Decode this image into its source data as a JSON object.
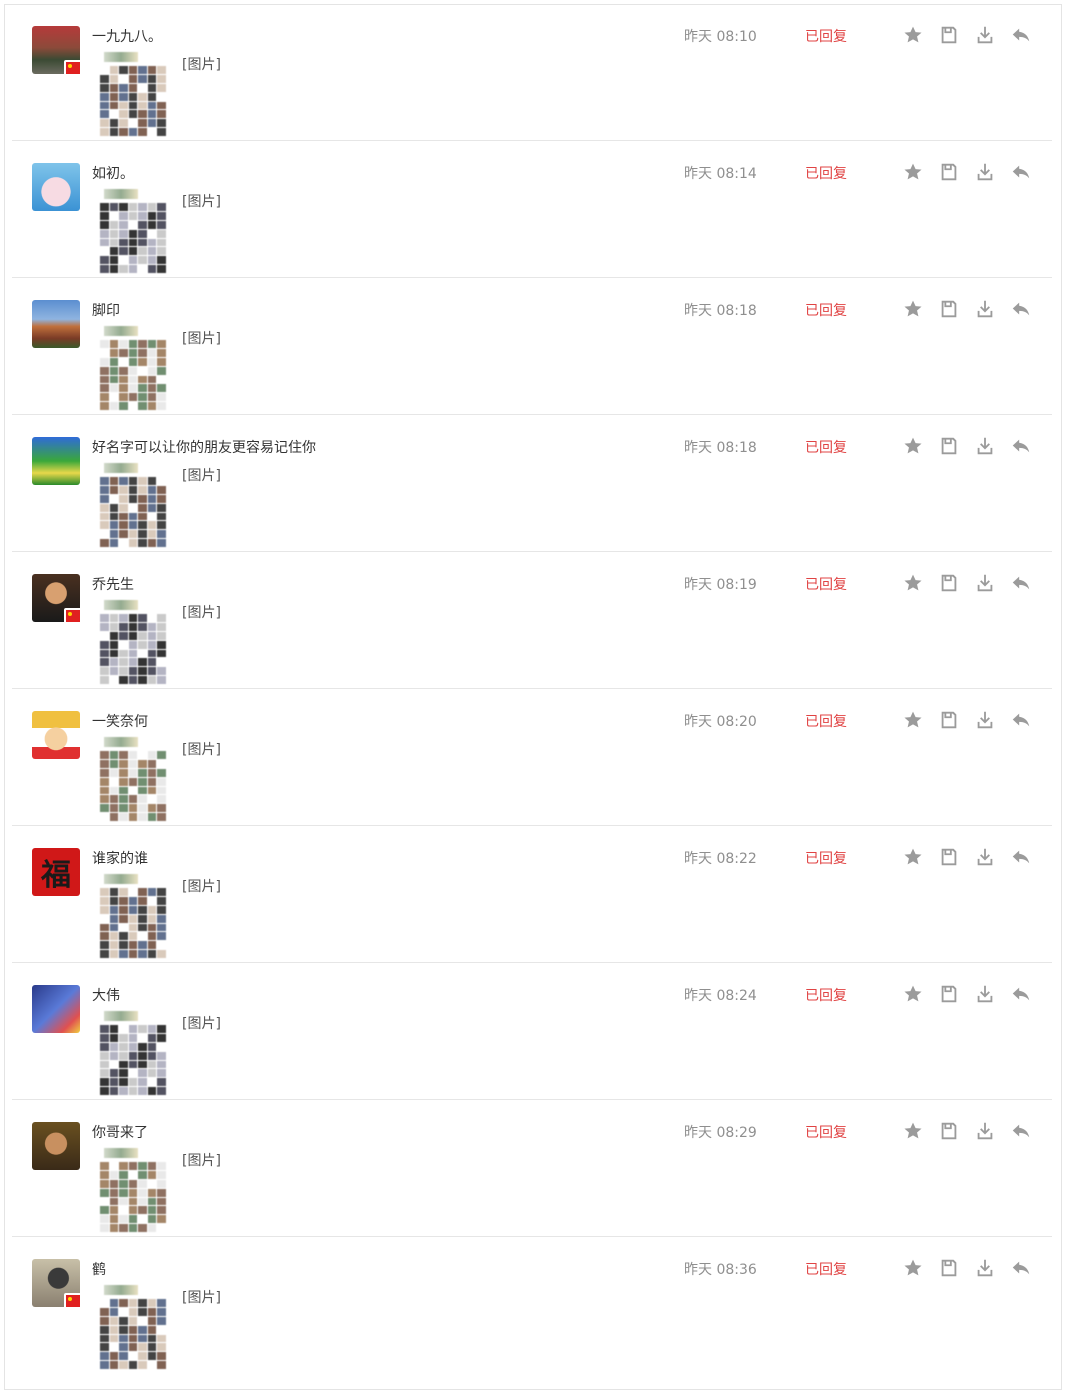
{
  "messages": [
    {
      "name": "一九九八。",
      "content": "[图片]",
      "time": "昨天 08:10",
      "status": "已回复",
      "avatar": "photo-person-road",
      "flag": true
    },
    {
      "name": "如初。",
      "content": "[图片]",
      "time": "昨天 08:14",
      "status": "已回复",
      "avatar": "cartoon-pig",
      "flag": false
    },
    {
      "name": "脚印",
      "content": "[图片]",
      "time": "昨天 08:18",
      "status": "已回复",
      "avatar": "building-sky",
      "flag": false
    },
    {
      "name": "好名字可以让你的朋友更容易记住你",
      "content": "[图片]",
      "time": "昨天 08:18",
      "status": "已回复",
      "avatar": "text-poster",
      "flag": false
    },
    {
      "name": "乔先生",
      "content": "[图片]",
      "time": "昨天 08:19",
      "status": "已回复",
      "avatar": "photo-man",
      "flag": true
    },
    {
      "name": "一笑奈何",
      "content": "[图片]",
      "time": "昨天 08:20",
      "status": "已回复",
      "avatar": "cartoon-straw-hat",
      "flag": false
    },
    {
      "name": "谁家的谁",
      "content": "[图片]",
      "time": "昨天 08:22",
      "status": "已回复",
      "avatar": "fu-character",
      "flag": false
    },
    {
      "name": "大伟",
      "content": "[图片]",
      "time": "昨天 08:24",
      "status": "已回复",
      "avatar": "fish-70",
      "flag": false
    },
    {
      "name": "你哥来了",
      "content": "[图片]",
      "time": "昨天 08:29",
      "status": "已回复",
      "avatar": "monkey-king",
      "flag": false
    },
    {
      "name": "鹤",
      "content": "[图片]",
      "time": "昨天 08:36",
      "status": "已回复",
      "avatar": "photo-man-car",
      "flag": true
    }
  ],
  "actions": {
    "star": "star-icon",
    "save": "save-icon",
    "download": "download-icon",
    "reply": "reply-icon"
  },
  "colors": {
    "status": "#e04343",
    "time": "#8f8f8f",
    "icon": "#9b9b9b",
    "divider": "#e6e6e6"
  }
}
